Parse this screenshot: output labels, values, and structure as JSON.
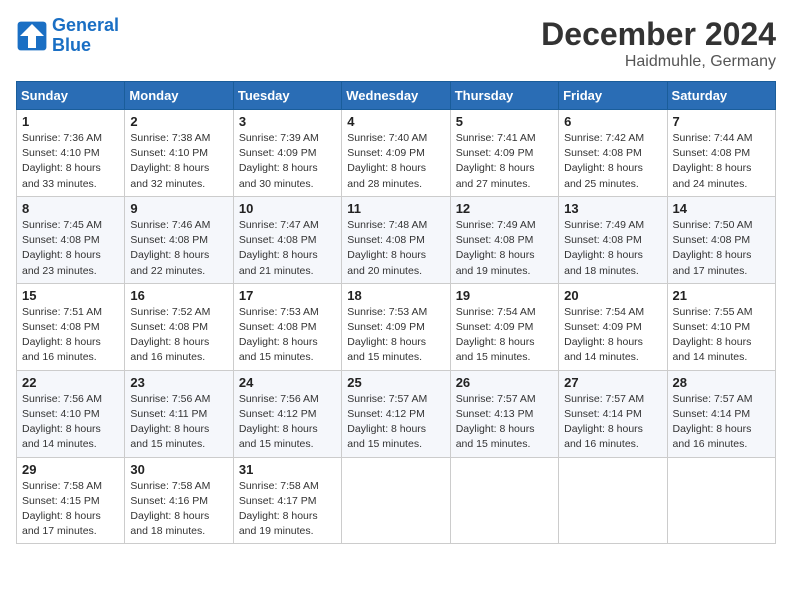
{
  "header": {
    "logo_line1": "General",
    "logo_line2": "Blue",
    "month": "December 2024",
    "location": "Haidmuhle, Germany"
  },
  "weekdays": [
    "Sunday",
    "Monday",
    "Tuesday",
    "Wednesday",
    "Thursday",
    "Friday",
    "Saturday"
  ],
  "weeks": [
    [
      {
        "day": "1",
        "sunrise": "7:36 AM",
        "sunset": "4:10 PM",
        "daylight": "8 hours and 33 minutes."
      },
      {
        "day": "2",
        "sunrise": "7:38 AM",
        "sunset": "4:10 PM",
        "daylight": "8 hours and 32 minutes."
      },
      {
        "day": "3",
        "sunrise": "7:39 AM",
        "sunset": "4:09 PM",
        "daylight": "8 hours and 30 minutes."
      },
      {
        "day": "4",
        "sunrise": "7:40 AM",
        "sunset": "4:09 PM",
        "daylight": "8 hours and 28 minutes."
      },
      {
        "day": "5",
        "sunrise": "7:41 AM",
        "sunset": "4:09 PM",
        "daylight": "8 hours and 27 minutes."
      },
      {
        "day": "6",
        "sunrise": "7:42 AM",
        "sunset": "4:08 PM",
        "daylight": "8 hours and 25 minutes."
      },
      {
        "day": "7",
        "sunrise": "7:44 AM",
        "sunset": "4:08 PM",
        "daylight": "8 hours and 24 minutes."
      }
    ],
    [
      {
        "day": "8",
        "sunrise": "7:45 AM",
        "sunset": "4:08 PM",
        "daylight": "8 hours and 23 minutes."
      },
      {
        "day": "9",
        "sunrise": "7:46 AM",
        "sunset": "4:08 PM",
        "daylight": "8 hours and 22 minutes."
      },
      {
        "day": "10",
        "sunrise": "7:47 AM",
        "sunset": "4:08 PM",
        "daylight": "8 hours and 21 minutes."
      },
      {
        "day": "11",
        "sunrise": "7:48 AM",
        "sunset": "4:08 PM",
        "daylight": "8 hours and 20 minutes."
      },
      {
        "day": "12",
        "sunrise": "7:49 AM",
        "sunset": "4:08 PM",
        "daylight": "8 hours and 19 minutes."
      },
      {
        "day": "13",
        "sunrise": "7:49 AM",
        "sunset": "4:08 PM",
        "daylight": "8 hours and 18 minutes."
      },
      {
        "day": "14",
        "sunrise": "7:50 AM",
        "sunset": "4:08 PM",
        "daylight": "8 hours and 17 minutes."
      }
    ],
    [
      {
        "day": "15",
        "sunrise": "7:51 AM",
        "sunset": "4:08 PM",
        "daylight": "8 hours and 16 minutes."
      },
      {
        "day": "16",
        "sunrise": "7:52 AM",
        "sunset": "4:08 PM",
        "daylight": "8 hours and 16 minutes."
      },
      {
        "day": "17",
        "sunrise": "7:53 AM",
        "sunset": "4:08 PM",
        "daylight": "8 hours and 15 minutes."
      },
      {
        "day": "18",
        "sunrise": "7:53 AM",
        "sunset": "4:09 PM",
        "daylight": "8 hours and 15 minutes."
      },
      {
        "day": "19",
        "sunrise": "7:54 AM",
        "sunset": "4:09 PM",
        "daylight": "8 hours and 15 minutes."
      },
      {
        "day": "20",
        "sunrise": "7:54 AM",
        "sunset": "4:09 PM",
        "daylight": "8 hours and 14 minutes."
      },
      {
        "day": "21",
        "sunrise": "7:55 AM",
        "sunset": "4:10 PM",
        "daylight": "8 hours and 14 minutes."
      }
    ],
    [
      {
        "day": "22",
        "sunrise": "7:56 AM",
        "sunset": "4:10 PM",
        "daylight": "8 hours and 14 minutes."
      },
      {
        "day": "23",
        "sunrise": "7:56 AM",
        "sunset": "4:11 PM",
        "daylight": "8 hours and 15 minutes."
      },
      {
        "day": "24",
        "sunrise": "7:56 AM",
        "sunset": "4:12 PM",
        "daylight": "8 hours and 15 minutes."
      },
      {
        "day": "25",
        "sunrise": "7:57 AM",
        "sunset": "4:12 PM",
        "daylight": "8 hours and 15 minutes."
      },
      {
        "day": "26",
        "sunrise": "7:57 AM",
        "sunset": "4:13 PM",
        "daylight": "8 hours and 15 minutes."
      },
      {
        "day": "27",
        "sunrise": "7:57 AM",
        "sunset": "4:14 PM",
        "daylight": "8 hours and 16 minutes."
      },
      {
        "day": "28",
        "sunrise": "7:57 AM",
        "sunset": "4:14 PM",
        "daylight": "8 hours and 16 minutes."
      }
    ],
    [
      {
        "day": "29",
        "sunrise": "7:58 AM",
        "sunset": "4:15 PM",
        "daylight": "8 hours and 17 minutes."
      },
      {
        "day": "30",
        "sunrise": "7:58 AM",
        "sunset": "4:16 PM",
        "daylight": "8 hours and 18 minutes."
      },
      {
        "day": "31",
        "sunrise": "7:58 AM",
        "sunset": "4:17 PM",
        "daylight": "8 hours and 19 minutes."
      },
      null,
      null,
      null,
      null
    ]
  ]
}
